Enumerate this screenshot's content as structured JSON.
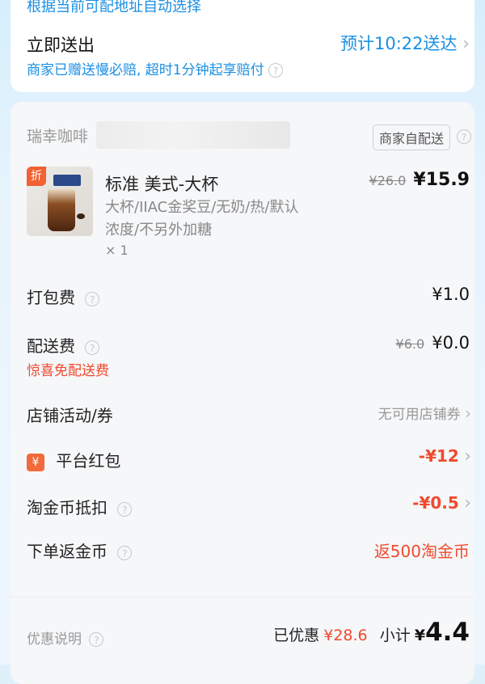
{
  "top": {
    "hint": "根据当前可配地址自动选择",
    "deliver_label": "立即送出",
    "eta": "预计10:22送达",
    "guarantee": "商家已赠送慢必赔, 超时1分钟起享赔付"
  },
  "store": {
    "name": "瑞幸咖啡",
    "delivery_tag": "商家自配送"
  },
  "product": {
    "badge": "折",
    "name": "标准 美式-大杯",
    "spec_line1": "大杯/IIAC金奖豆/无奶/热/默认",
    "spec_line2": "浓度/不另外加糖",
    "qty": "× 1",
    "orig_price": "¥26.0",
    "price": "¥15.9"
  },
  "fees": {
    "packing_label": "打包费",
    "packing_value": "¥1.0",
    "delivery_label": "配送费",
    "delivery_orig": "¥6.0",
    "delivery_value": "¥0.0",
    "delivery_note": "惊喜免配送费"
  },
  "promos": {
    "store_label": "店铺活动/券",
    "store_value": "无可用店铺券",
    "redpacket_icon": "¥",
    "redpacket_label": "平台红包",
    "redpacket_value": "-¥12",
    "coin_deduct_label": "淘金币抵扣",
    "coin_deduct_value": "-¥0.5",
    "coin_return_label": "下单返金币",
    "coin_return_value": "返500淘金币"
  },
  "summary": {
    "discount_label": "优惠说明",
    "saved_label": "已优惠",
    "saved_value": "¥28.6",
    "subtotal_label": "小计",
    "subtotal_currency": "¥",
    "subtotal_value": "4.4"
  },
  "colors": {
    "accent_blue": "#1a8fe3",
    "accent_red": "#f04a2e"
  }
}
